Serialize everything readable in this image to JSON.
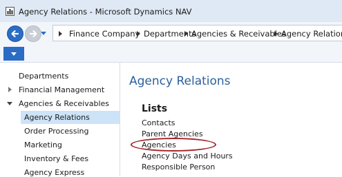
{
  "window": {
    "title": "Agency Relations - Microsoft Dynamics NAV"
  },
  "breadcrumb": [
    "Finance Company",
    "Departments",
    "Agencies & Receivables",
    "Agency Relations"
  ],
  "sidebar": {
    "items": [
      {
        "label": "Departments"
      },
      {
        "label": "Financial Management"
      },
      {
        "label": "Agencies & Receivables"
      },
      {
        "label": "Agency Relations"
      },
      {
        "label": "Order Processing"
      },
      {
        "label": "Marketing"
      },
      {
        "label": "Inventory & Fees"
      },
      {
        "label": "Agency Express"
      }
    ]
  },
  "main": {
    "title": "Agency Relations",
    "lists_heading": "Lists",
    "lists": [
      "Contacts",
      "Parent Agencies",
      "Agencies",
      "Agency Days and Hours",
      "Responsible Person"
    ]
  },
  "colors": {
    "accent": "#2b6cc4",
    "title": "#2b5f9e",
    "selection": "#cde3f7",
    "highlight_oval": "#a3262d"
  },
  "icons": [
    "app-icon",
    "back-arrow-icon",
    "forward-arrow-icon",
    "dropdown-caret-icon",
    "breadcrumb-separator-icon",
    "expand-icon",
    "collapse-icon"
  ]
}
